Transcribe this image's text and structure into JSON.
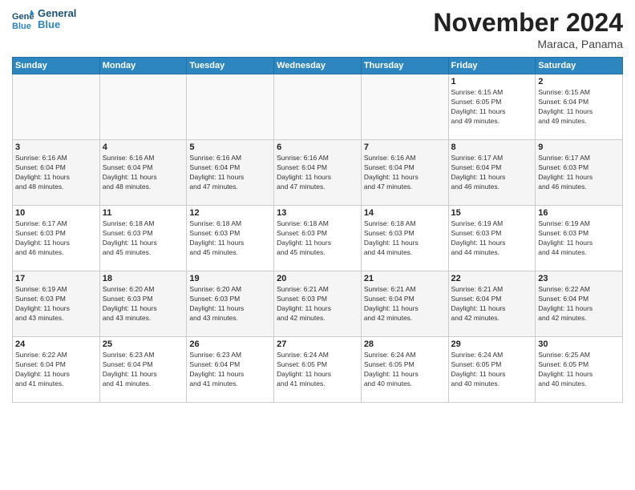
{
  "logo": {
    "line1": "General",
    "line2": "Blue"
  },
  "title": "November 2024",
  "location": "Maraca, Panama",
  "days_header": [
    "Sunday",
    "Monday",
    "Tuesday",
    "Wednesday",
    "Thursday",
    "Friday",
    "Saturday"
  ],
  "weeks": [
    [
      {
        "day": "",
        "info": ""
      },
      {
        "day": "",
        "info": ""
      },
      {
        "day": "",
        "info": ""
      },
      {
        "day": "",
        "info": ""
      },
      {
        "day": "",
        "info": ""
      },
      {
        "day": "1",
        "info": "Sunrise: 6:15 AM\nSunset: 6:05 PM\nDaylight: 11 hours\nand 49 minutes."
      },
      {
        "day": "2",
        "info": "Sunrise: 6:15 AM\nSunset: 6:04 PM\nDaylight: 11 hours\nand 49 minutes."
      }
    ],
    [
      {
        "day": "3",
        "info": "Sunrise: 6:16 AM\nSunset: 6:04 PM\nDaylight: 11 hours\nand 48 minutes."
      },
      {
        "day": "4",
        "info": "Sunrise: 6:16 AM\nSunset: 6:04 PM\nDaylight: 11 hours\nand 48 minutes."
      },
      {
        "day": "5",
        "info": "Sunrise: 6:16 AM\nSunset: 6:04 PM\nDaylight: 11 hours\nand 47 minutes."
      },
      {
        "day": "6",
        "info": "Sunrise: 6:16 AM\nSunset: 6:04 PM\nDaylight: 11 hours\nand 47 minutes."
      },
      {
        "day": "7",
        "info": "Sunrise: 6:16 AM\nSunset: 6:04 PM\nDaylight: 11 hours\nand 47 minutes."
      },
      {
        "day": "8",
        "info": "Sunrise: 6:17 AM\nSunset: 6:04 PM\nDaylight: 11 hours\nand 46 minutes."
      },
      {
        "day": "9",
        "info": "Sunrise: 6:17 AM\nSunset: 6:03 PM\nDaylight: 11 hours\nand 46 minutes."
      }
    ],
    [
      {
        "day": "10",
        "info": "Sunrise: 6:17 AM\nSunset: 6:03 PM\nDaylight: 11 hours\nand 46 minutes."
      },
      {
        "day": "11",
        "info": "Sunrise: 6:18 AM\nSunset: 6:03 PM\nDaylight: 11 hours\nand 45 minutes."
      },
      {
        "day": "12",
        "info": "Sunrise: 6:18 AM\nSunset: 6:03 PM\nDaylight: 11 hours\nand 45 minutes."
      },
      {
        "day": "13",
        "info": "Sunrise: 6:18 AM\nSunset: 6:03 PM\nDaylight: 11 hours\nand 45 minutes."
      },
      {
        "day": "14",
        "info": "Sunrise: 6:18 AM\nSunset: 6:03 PM\nDaylight: 11 hours\nand 44 minutes."
      },
      {
        "day": "15",
        "info": "Sunrise: 6:19 AM\nSunset: 6:03 PM\nDaylight: 11 hours\nand 44 minutes."
      },
      {
        "day": "16",
        "info": "Sunrise: 6:19 AM\nSunset: 6:03 PM\nDaylight: 11 hours\nand 44 minutes."
      }
    ],
    [
      {
        "day": "17",
        "info": "Sunrise: 6:19 AM\nSunset: 6:03 PM\nDaylight: 11 hours\nand 43 minutes."
      },
      {
        "day": "18",
        "info": "Sunrise: 6:20 AM\nSunset: 6:03 PM\nDaylight: 11 hours\nand 43 minutes."
      },
      {
        "day": "19",
        "info": "Sunrise: 6:20 AM\nSunset: 6:03 PM\nDaylight: 11 hours\nand 43 minutes."
      },
      {
        "day": "20",
        "info": "Sunrise: 6:21 AM\nSunset: 6:03 PM\nDaylight: 11 hours\nand 42 minutes."
      },
      {
        "day": "21",
        "info": "Sunrise: 6:21 AM\nSunset: 6:04 PM\nDaylight: 11 hours\nand 42 minutes."
      },
      {
        "day": "22",
        "info": "Sunrise: 6:21 AM\nSunset: 6:04 PM\nDaylight: 11 hours\nand 42 minutes."
      },
      {
        "day": "23",
        "info": "Sunrise: 6:22 AM\nSunset: 6:04 PM\nDaylight: 11 hours\nand 42 minutes."
      }
    ],
    [
      {
        "day": "24",
        "info": "Sunrise: 6:22 AM\nSunset: 6:04 PM\nDaylight: 11 hours\nand 41 minutes."
      },
      {
        "day": "25",
        "info": "Sunrise: 6:23 AM\nSunset: 6:04 PM\nDaylight: 11 hours\nand 41 minutes."
      },
      {
        "day": "26",
        "info": "Sunrise: 6:23 AM\nSunset: 6:04 PM\nDaylight: 11 hours\nand 41 minutes."
      },
      {
        "day": "27",
        "info": "Sunrise: 6:24 AM\nSunset: 6:05 PM\nDaylight: 11 hours\nand 41 minutes."
      },
      {
        "day": "28",
        "info": "Sunrise: 6:24 AM\nSunset: 6:05 PM\nDaylight: 11 hours\nand 40 minutes."
      },
      {
        "day": "29",
        "info": "Sunrise: 6:24 AM\nSunset: 6:05 PM\nDaylight: 11 hours\nand 40 minutes."
      },
      {
        "day": "30",
        "info": "Sunrise: 6:25 AM\nSunset: 6:05 PM\nDaylight: 11 hours\nand 40 minutes."
      }
    ]
  ]
}
